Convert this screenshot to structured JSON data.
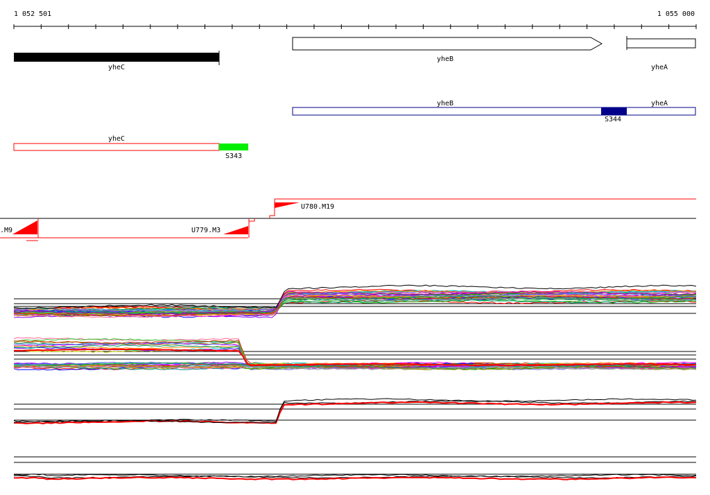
{
  "ruler": {
    "start_label": "1 052 501",
    "end_label": "1 055 000"
  },
  "genes": {
    "yheC": "yheC",
    "yheB": "yheB",
    "yheA": "yheA"
  },
  "transcripts": {
    "yheB": "yheB",
    "yheA": "yheA",
    "yheC": "yheC",
    "S344": "S344",
    "S343": "S343"
  },
  "segments": {
    "u779_m9": ".M9",
    "u779_m3": "U779.M3",
    "u780_m19": "U780.M19"
  },
  "colors": {
    "gene_black": "#000000",
    "transcript_blue": "#00008b",
    "transcript_red": "#ff0000",
    "s344_fill": "#00008b",
    "s343_fill": "#00ee00",
    "segment_red": "#ff0000"
  }
}
